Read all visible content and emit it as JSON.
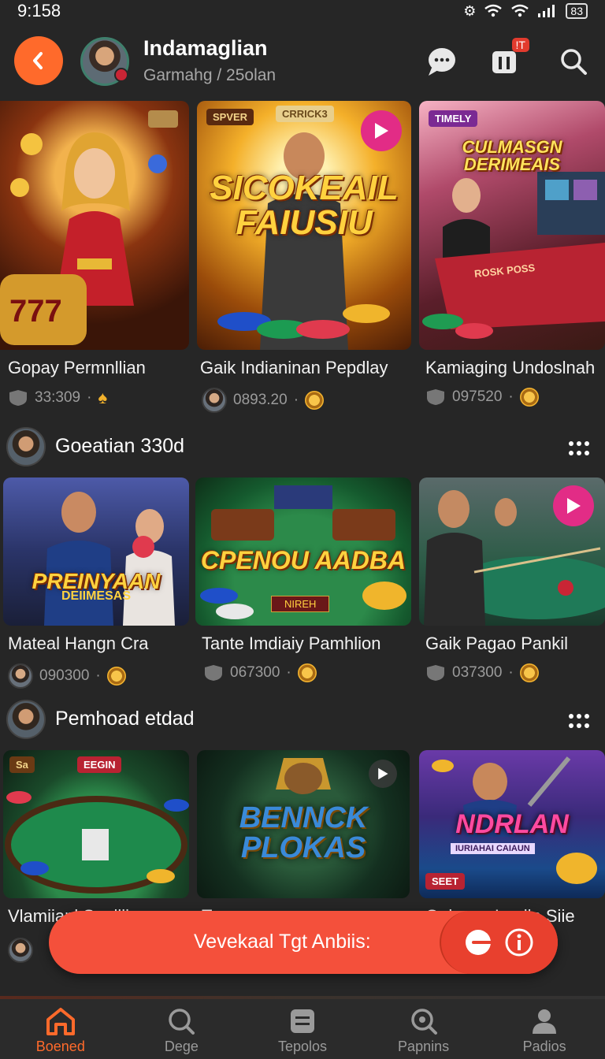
{
  "status_bar": {
    "time": "9:158",
    "battery": "83"
  },
  "header": {
    "channel_name": "Indamaglian",
    "channel_sub": "Garmahg / 25olan",
    "notification_badge": "!T",
    "accent_color": "#ff6a2b"
  },
  "row1": [
    {
      "title": "Gopay Permnllian",
      "count": "33:309",
      "thumb_tag": ""
    },
    {
      "title": "Gaik Indianinan Pepdlay",
      "count": "0893.20",
      "thumb_tag": "SPVER",
      "thumb_tag2": "CRRICK3",
      "thumb_title": "SICOKEAIL FAIUSIU"
    },
    {
      "title": "Kamiaging Undoslnah",
      "count": "097520",
      "thumb_tag": "TIMELY",
      "thumb_title": "CULMASGN DERIMEAIS",
      "thumb_sub": "ROSK POSS"
    }
  ],
  "section2": {
    "title": "Goeatian 330d"
  },
  "row2": [
    {
      "title": "Mateal Hangn Cra",
      "count": "090300",
      "thumb_title": "PREINYAAN",
      "thumb_sub": "DEIIMESAS"
    },
    {
      "title": "Tante Imdiaiy Pamhlion",
      "count": "067300",
      "thumb_title": "CPENOU AADBA",
      "thumb_sub": "NIREH"
    },
    {
      "title": "Gaik Pagao Pankil",
      "count": "037300"
    }
  ],
  "section3": {
    "title": "Pemhoad etdad"
  },
  "row3": [
    {
      "title": "Vlamiianl Saalllia",
      "thumb_tag": "Sa",
      "thumb_tag2": "EEGIN"
    },
    {
      "title": "Tan",
      "thumb_title": "BENNCK PLOKAS"
    },
    {
      "title": "Oalsana Lanlln Siie",
      "thumb_title": "NDRLAN",
      "thumb_sub": "IURIAHAI CAIAUN",
      "thumb_tag": "SEET"
    }
  ],
  "toast": {
    "label": "Vevekaal Tgt Anbiis:"
  },
  "bottom_nav": [
    {
      "label": "Boened",
      "icon": "home-icon",
      "active": true
    },
    {
      "label": "Dege",
      "icon": "search-icon",
      "active": false
    },
    {
      "label": "Tepolos",
      "icon": "list-icon",
      "active": false
    },
    {
      "label": "Papnins",
      "icon": "discover-icon",
      "active": false
    },
    {
      "label": "Padios",
      "icon": "profile-icon",
      "active": false
    }
  ]
}
